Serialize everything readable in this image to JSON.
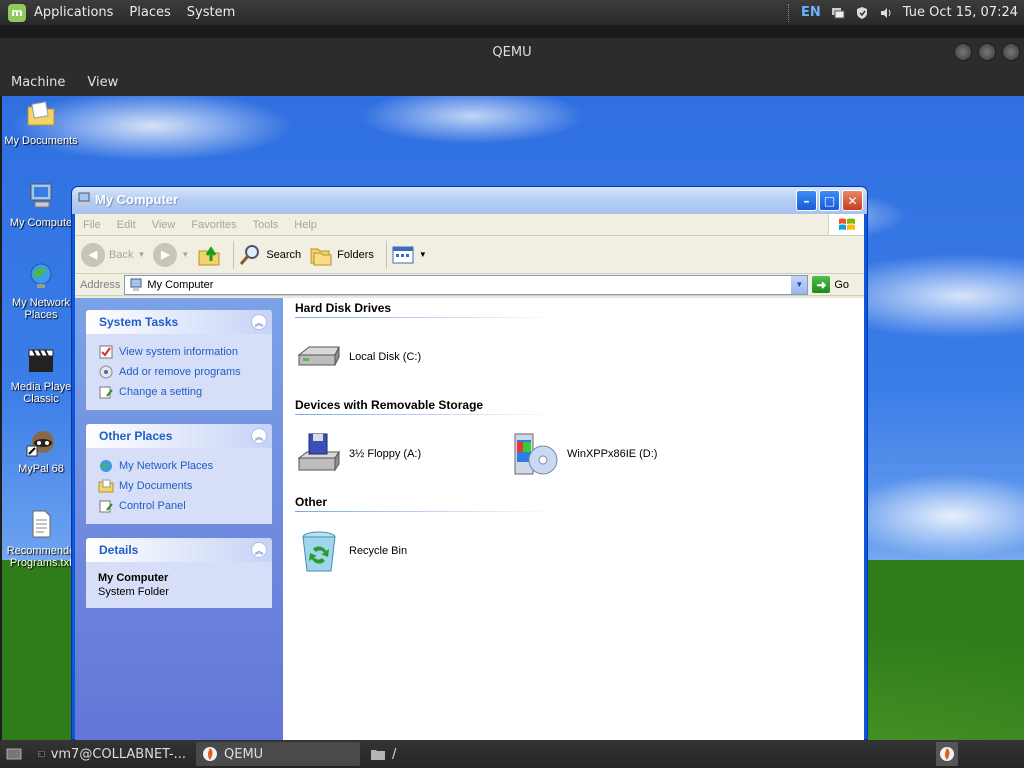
{
  "top_panel": {
    "menus": [
      "Applications",
      "Places",
      "System"
    ],
    "lang": "EN",
    "clock": "Tue Oct 15, 07:24"
  },
  "qemu": {
    "title": "QEMU",
    "menus": [
      "Machine",
      "View"
    ]
  },
  "desktop_icons": [
    {
      "label": "My Documents"
    },
    {
      "label": "My Compute"
    },
    {
      "label": "My Network Places"
    },
    {
      "label": "Media Playe Classic"
    },
    {
      "label": "MyPal 68"
    },
    {
      "label": "Recommende Programs.txt"
    }
  ],
  "explorer": {
    "title": "My Computer",
    "menus": [
      "File",
      "Edit",
      "View",
      "Favorites",
      "Tools",
      "Help"
    ],
    "toolbar": {
      "back": "Back",
      "search": "Search",
      "folders": "Folders"
    },
    "address": {
      "label": "Address",
      "value": "My Computer",
      "go": "Go"
    },
    "task_pane": {
      "system_tasks": {
        "title": "System Tasks",
        "links": [
          "View system information",
          "Add or remove programs",
          "Change a setting"
        ]
      },
      "other_places": {
        "title": "Other Places",
        "links": [
          "My Network Places",
          "My Documents",
          "Control Panel"
        ]
      },
      "details": {
        "title": "Details",
        "name": "My Computer",
        "type": "System Folder"
      }
    },
    "groups": {
      "hard_disks": {
        "title": "Hard Disk Drives",
        "items": [
          "Local Disk (C:)"
        ]
      },
      "removable": {
        "title": "Devices with Removable Storage",
        "items": [
          "3½ Floppy (A:)",
          "WinXPPx86IE (D:)"
        ]
      },
      "other": {
        "title": "Other",
        "items": [
          "Recycle Bin"
        ]
      }
    }
  },
  "bottom_panel": {
    "tasks": [
      "vm7@COLLABNET-...",
      "QEMU",
      "/"
    ]
  }
}
